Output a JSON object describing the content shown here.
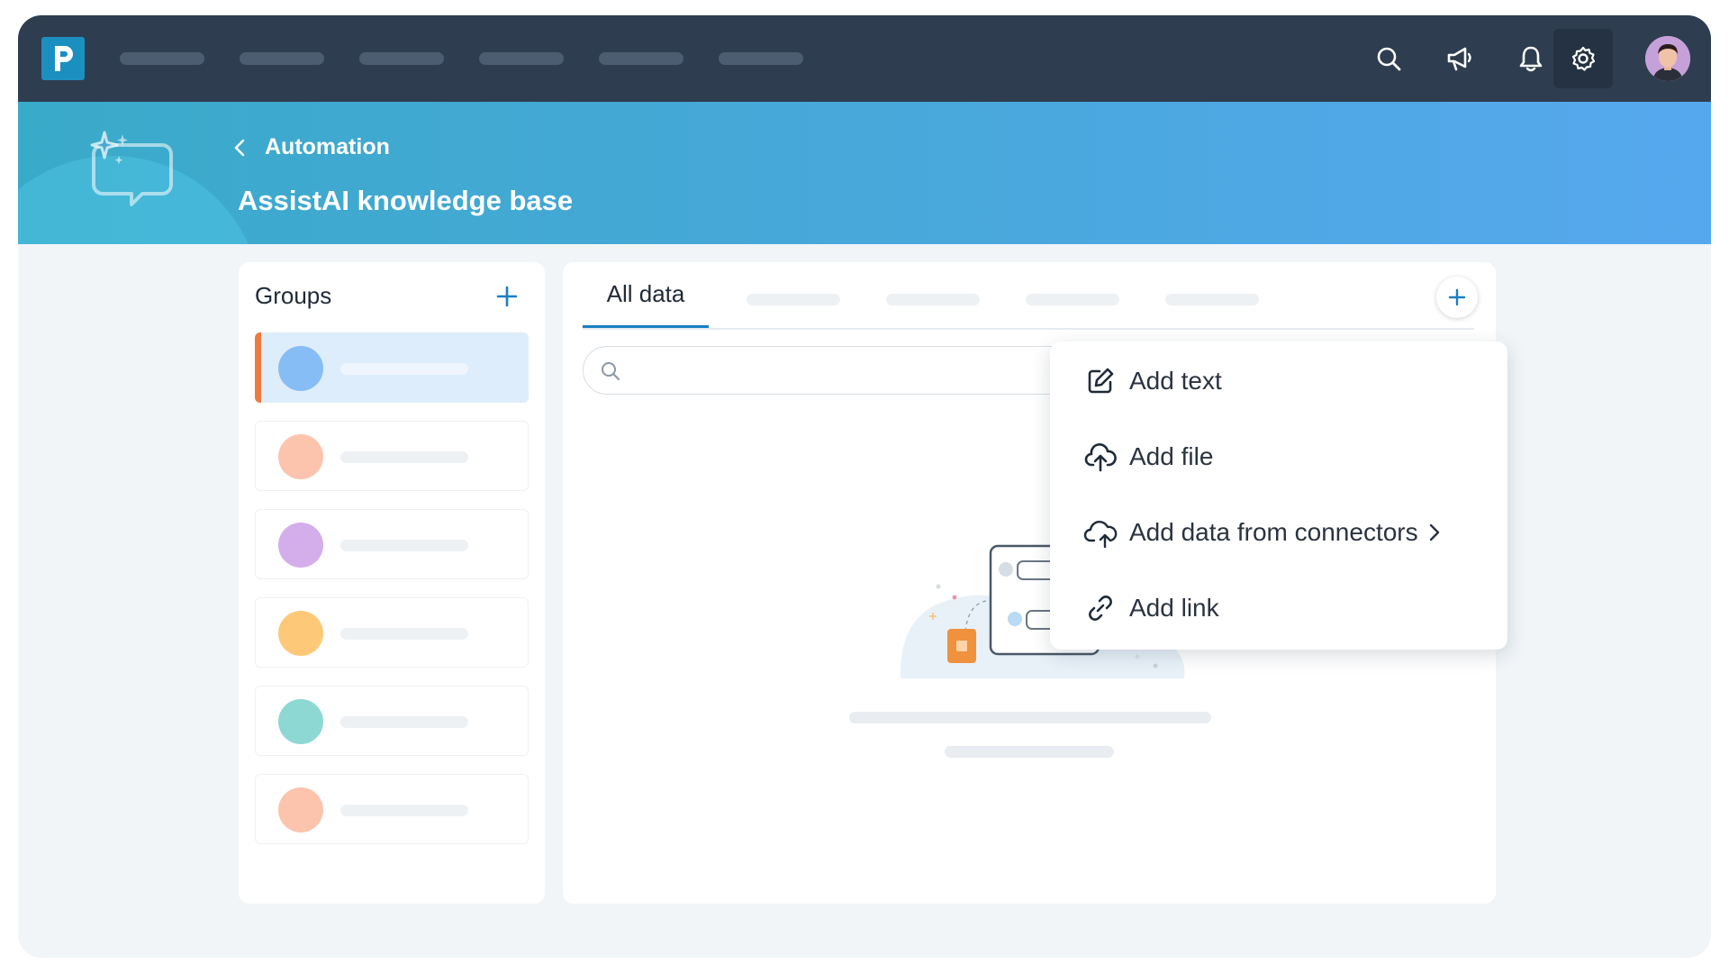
{
  "nav": {
    "logo_letter": "P",
    "icons": [
      "search-icon",
      "megaphone-icon",
      "bell-icon",
      "gear-icon"
    ],
    "colors": {
      "bar": "#2e3d50",
      "logo": "#1b8fc0"
    }
  },
  "header": {
    "breadcrumb": "Automation",
    "title": "AssistAI knowledge base",
    "colors": {
      "start": "#3aaac9",
      "end": "#56a8ee"
    }
  },
  "groups": {
    "title": "Groups",
    "items": [
      {
        "color": "#86bdf4",
        "selected": true
      },
      {
        "color": "#fcc4ad",
        "selected": false
      },
      {
        "color": "#d4aeeb",
        "selected": false
      },
      {
        "color": "#fdc979",
        "selected": false
      },
      {
        "color": "#8dd8d3",
        "selected": false
      },
      {
        "color": "#fcc4ad",
        "selected": false
      }
    ],
    "accent": "#ee7a3d"
  },
  "main": {
    "active_tab": "All data"
  },
  "menu": {
    "items": [
      {
        "label": "Add text",
        "icon": "edit-icon"
      },
      {
        "label": "Add file",
        "icon": "upload-cloud-icon"
      },
      {
        "label": "Add data from connectors",
        "icon": "cloud-upload-icon",
        "submenu": true
      },
      {
        "label": "Add link",
        "icon": "link-icon"
      }
    ]
  }
}
